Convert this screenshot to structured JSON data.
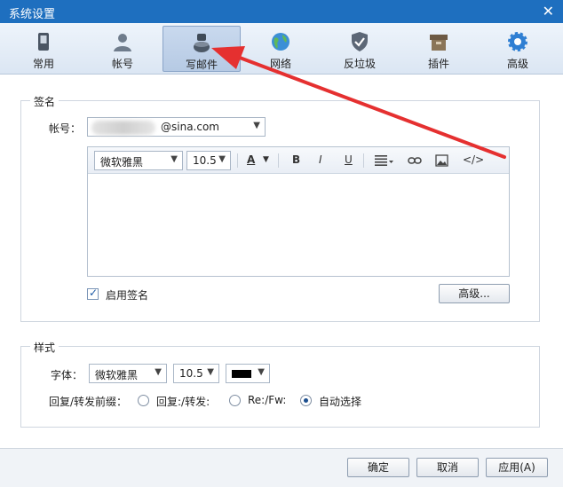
{
  "window": {
    "title": "系统设置"
  },
  "toolbar": {
    "items": [
      {
        "label": "常用",
        "icon": "phone-icon"
      },
      {
        "label": "帐号",
        "icon": "user-icon"
      },
      {
        "label": "写邮件",
        "icon": "compose-icon",
        "active": true
      },
      {
        "label": "网络",
        "icon": "globe-icon"
      },
      {
        "label": "反垃圾",
        "icon": "shield-icon"
      },
      {
        "label": "插件",
        "icon": "box-icon"
      },
      {
        "label": "高级",
        "icon": "gear-icon"
      }
    ]
  },
  "signature": {
    "section_title": "签名",
    "account_label": "帐号：",
    "account_value": "@sina.com",
    "editor": {
      "font": "微软雅黑",
      "size": "10.5",
      "bold": "B",
      "italic": "I",
      "underline": "U",
      "source": "</>"
    },
    "enable_label": "启用签名",
    "advanced_label": "高级..."
  },
  "style": {
    "section_title": "样式",
    "font_label": "字体：",
    "font": "微软雅黑",
    "size": "10.5",
    "color": "#000000",
    "prefix_label": "回复/转发前缀：",
    "options": [
      "回复:/转发:",
      "Re:/Fw:",
      "自动选择"
    ],
    "selected": "自动选择"
  },
  "footer": {
    "ok": "确定",
    "cancel": "取消",
    "apply": "应用(A)"
  },
  "colors": {
    "titlebar": "#1e6fbf",
    "annotation_arrow": "#e53030"
  }
}
